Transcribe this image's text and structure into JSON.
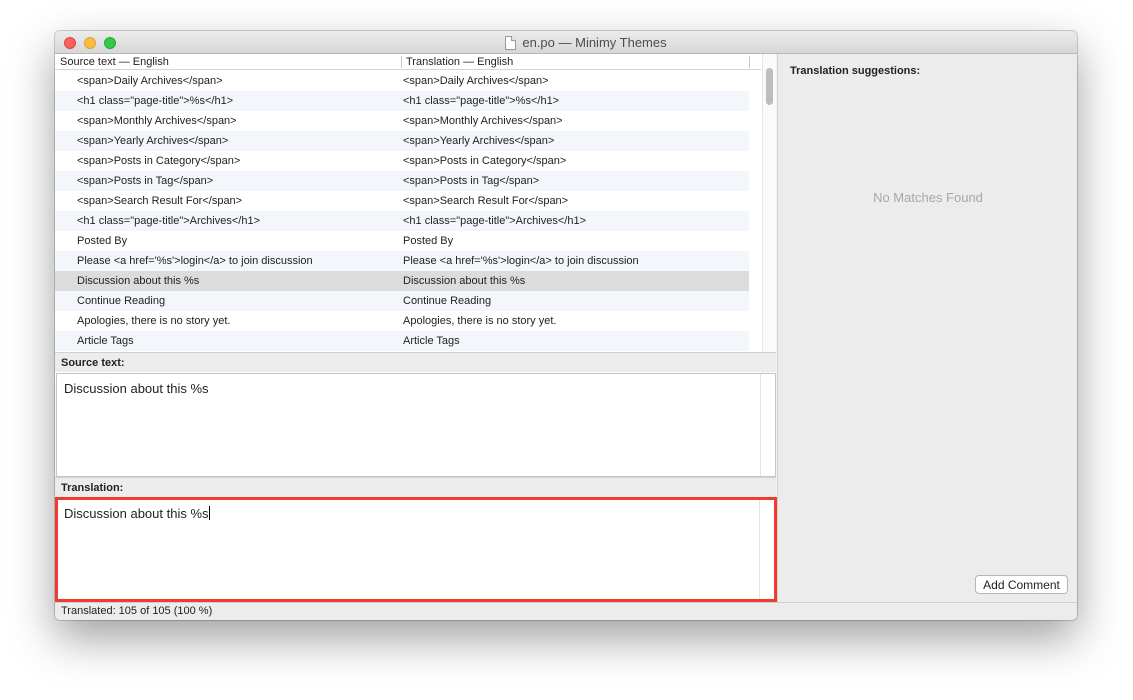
{
  "window": {
    "title": "en.po — Minimy Themes"
  },
  "list": {
    "columns": {
      "source": "Source text — English",
      "translation": "Translation — English"
    },
    "rows": [
      {
        "source": "<span>Daily Archives</span>",
        "translation": "<span>Daily Archives</span>"
      },
      {
        "source": "<h1 class=\"page-title\">%s</h1>",
        "translation": "<h1 class=\"page-title\">%s</h1>"
      },
      {
        "source": "<span>Monthly Archives</span>",
        "translation": "<span>Monthly Archives</span>"
      },
      {
        "source": "<span>Yearly Archives</span>",
        "translation": "<span>Yearly Archives</span>"
      },
      {
        "source": "<span>Posts in Category</span>",
        "translation": "<span>Posts in Category</span>"
      },
      {
        "source": "<span>Posts in Tag</span>",
        "translation": "<span>Posts in Tag</span>"
      },
      {
        "source": "<span>Search Result For</span>",
        "translation": "<span>Search Result For</span>"
      },
      {
        "source": "<h1 class=\"page-title\">Archives</h1>",
        "translation": "<h1 class=\"page-title\">Archives</h1>"
      },
      {
        "source": "Posted By",
        "translation": "Posted By"
      },
      {
        "source": "Please <a href='%s'>login</a> to join discussion",
        "translation": "Please <a href='%s'>login</a> to join discussion"
      },
      {
        "source": "Discussion about this %s",
        "translation": "Discussion about this %s",
        "selected": true
      },
      {
        "source": "Continue Reading",
        "translation": "Continue Reading"
      },
      {
        "source": "Apologies, there is no story yet.",
        "translation": "Apologies, there is no story yet."
      },
      {
        "source": "Article Tags",
        "translation": "Article Tags"
      }
    ]
  },
  "source_panel": {
    "label": "Source text:",
    "text": "Discussion about this %s"
  },
  "translation_panel": {
    "label": "Translation:",
    "text": "Discussion about this %s",
    "highlight_color": "#f03a32"
  },
  "suggestions": {
    "title": "Translation suggestions:",
    "empty_message": "No Matches Found",
    "add_comment_label": "Add Comment"
  },
  "status": {
    "text": "Translated: 105 of 105 (100 %)"
  }
}
